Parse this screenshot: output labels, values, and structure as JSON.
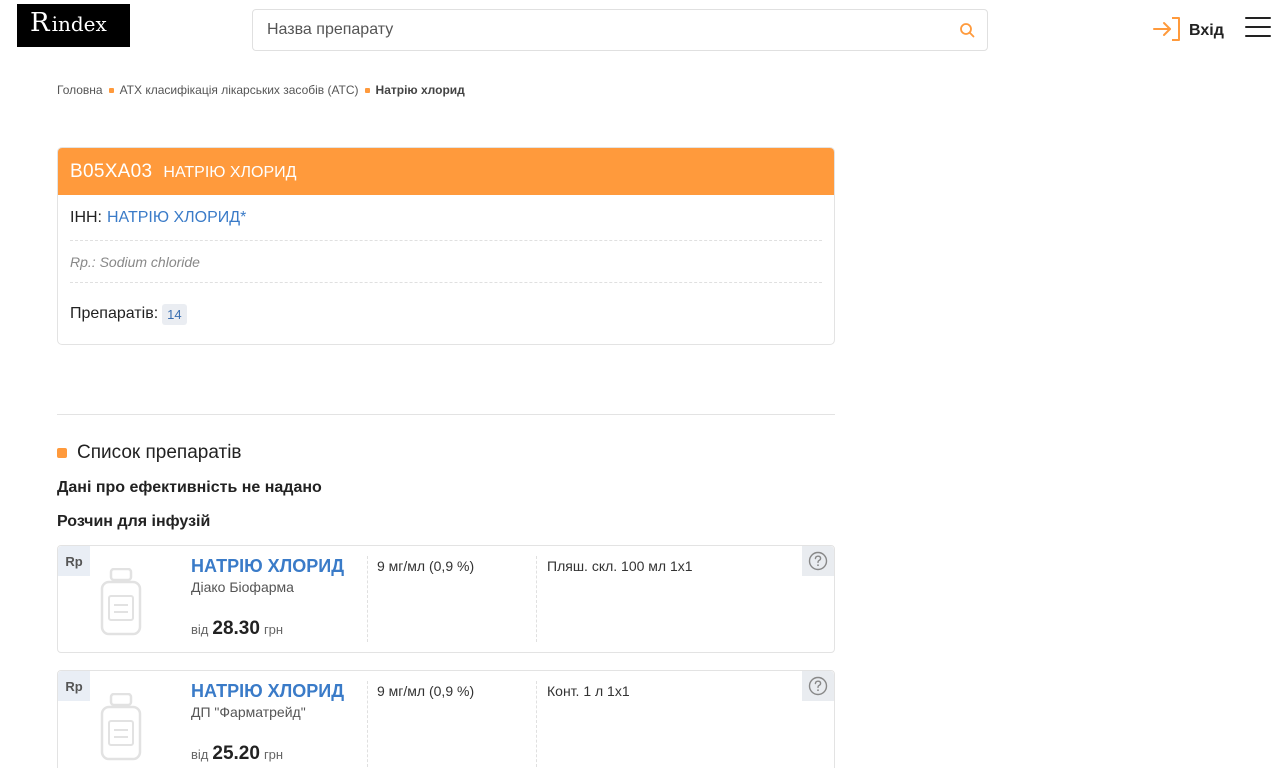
{
  "header": {
    "logo_r": "R",
    "logo_text": "index",
    "search_placeholder": "Назва препарату",
    "login_label": "Вхід"
  },
  "breadcrumb": {
    "items": [
      "Головна",
      "АТХ класифікація лікарських засобів (АТС)"
    ],
    "current": "Натрію хлорид"
  },
  "card": {
    "code": "B05XA03",
    "name": "НАТРІЮ ХЛОРИД",
    "inn_label": "ІНН:",
    "inn_value": "НАТРІЮ ХЛОРИД*",
    "rp": "Rp.: Sodium chloride",
    "count_label": "Препаратів:",
    "count": "14"
  },
  "list": {
    "title": "Список препаратів",
    "efficacy": "Дані про ефективність не надано",
    "form": "Розчин для інфузій",
    "products": [
      {
        "rp": "Rp",
        "name": "НАТРІЮ ХЛОРИД",
        "maker": "Діако Біофарма",
        "price_prefix": "від",
        "price": "28.30",
        "currency": "грн",
        "dose": "9 мг/мл (0,9 %)",
        "pack": "Пляш. скл. 100 мл 1х1"
      },
      {
        "rp": "Rp",
        "name": "НАТРІЮ ХЛОРИД",
        "maker": "ДП \"Фарматрейд\"",
        "price_prefix": "від",
        "price": "25.20",
        "currency": "грн",
        "dose": "9 мг/мл (0,9 %)",
        "pack": "Конт. 1 л 1х1"
      }
    ]
  },
  "colors": {
    "accent": "#ff9a3c",
    "link": "#3a7bc8"
  },
  "icons": {
    "search": "search-icon",
    "login": "login-icon",
    "menu": "hamburger-menu-icon",
    "help": "question-icon",
    "bottle": "bottle-icon"
  }
}
